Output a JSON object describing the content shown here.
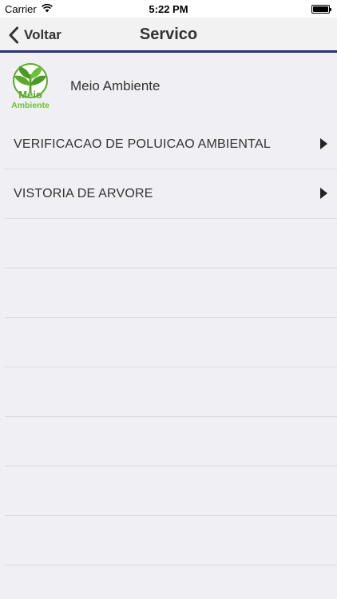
{
  "status_bar": {
    "carrier": "Carrier",
    "time": "5:22 PM",
    "wifi_icon": "wifi-icon",
    "battery_icon": "battery-full-icon"
  },
  "nav": {
    "back_label": "Voltar",
    "back_icon": "chevron-left-icon",
    "title": "Servico",
    "accent_color": "#2b2f82"
  },
  "category": {
    "name": "Meio Ambiente",
    "logo_text_top": "Meio",
    "logo_text_bottom": "Ambiente",
    "logo_color": "#5ba82e"
  },
  "services": [
    {
      "label": "VERIFICACAO DE POLUICAO AMBIENTAL"
    },
    {
      "label": "VISTORIA DE ARVORE"
    }
  ]
}
